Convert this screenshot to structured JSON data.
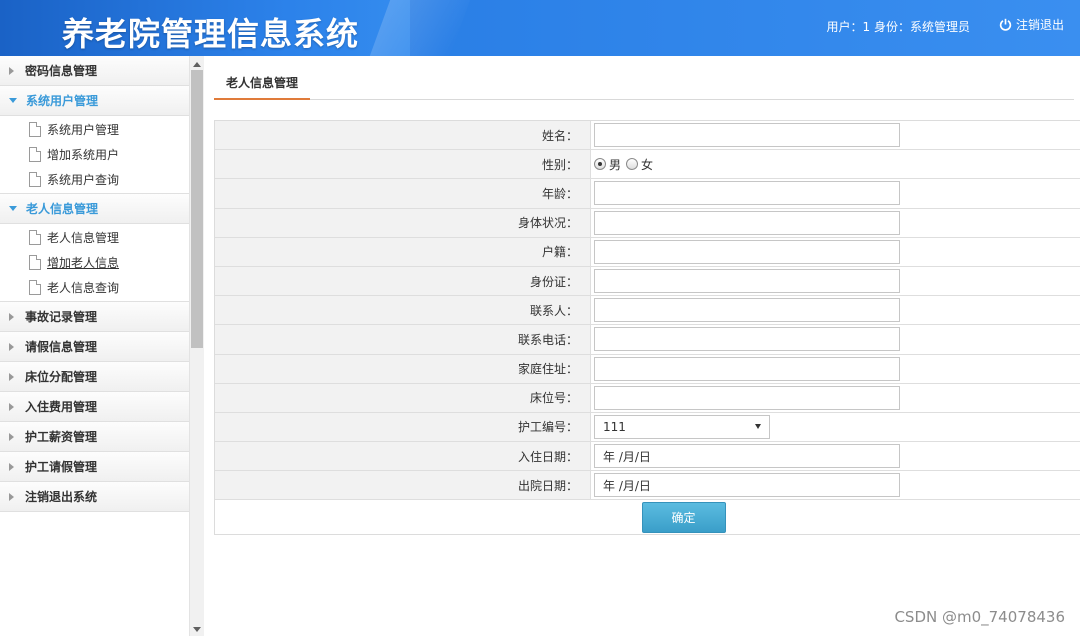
{
  "header": {
    "title": "养老院管理信息系统",
    "user_info": "用户：1 身份：系统管理员",
    "logout_label": "注销退出"
  },
  "sidebar": {
    "groups": [
      {
        "label": "密码信息管理",
        "open": false
      },
      {
        "label": "系统用户管理",
        "open": true,
        "items": [
          "系统用户管理",
          "增加系统用户",
          "系统用户查询"
        ]
      },
      {
        "label": "老人信息管理",
        "open": true,
        "items": [
          "老人信息管理",
          "增加老人信息",
          "老人信息查询"
        ]
      },
      {
        "label": "事故记录管理",
        "open": false
      },
      {
        "label": "请假信息管理",
        "open": false
      },
      {
        "label": "床位分配管理",
        "open": false
      },
      {
        "label": "入住费用管理",
        "open": false
      },
      {
        "label": "护工薪资管理",
        "open": false
      },
      {
        "label": "护工请假管理",
        "open": false
      },
      {
        "label": "注销退出系统",
        "open": false
      }
    ]
  },
  "main": {
    "tab_label": "老人信息管理",
    "form": {
      "name_label": "姓名：",
      "gender_label": "性别：",
      "gender_options": [
        "男",
        "女"
      ],
      "gender_selected": "男",
      "age_label": "年龄：",
      "health_label": "身体状况：",
      "census_label": "户籍：",
      "idcard_label": "身份证：",
      "contact_label": "联系人：",
      "phone_label": "联系电话：",
      "address_label": "家庭住址：",
      "bed_label": "床位号：",
      "nurse_label": "护工编号：",
      "nurse_value": "111",
      "checkin_label": "入住日期：",
      "checkin_placeholder": "年 /月/日",
      "checkout_label": "出院日期：",
      "checkout_placeholder": "年 /月/日",
      "submit_label": "确定"
    }
  },
  "watermark": "CSDN @m0_74078436"
}
